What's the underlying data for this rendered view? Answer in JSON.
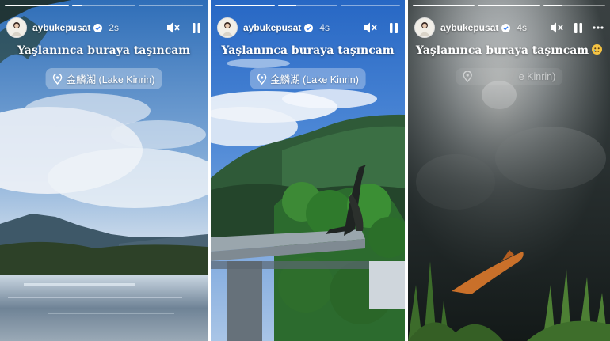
{
  "panels": [
    {
      "username": "aybukepusat",
      "time": "2s",
      "caption": "Yaşlanınca buraya taşıncam",
      "location": "金鱗湖 (Lake Kinrin)",
      "progress": [
        1,
        0.15,
        0
      ]
    },
    {
      "username": "aybukepusat",
      "time": "4s",
      "caption": "Yaşlanınca buraya taşıncam",
      "location": "金鱗湖 (Lake Kinrin)",
      "progress": [
        1,
        0.3,
        0
      ]
    },
    {
      "username": "aybukepusat",
      "time": "4s",
      "caption": "Yaşlanınca buraya taşıncam",
      "location": "e Kinrin)",
      "progress": [
        1,
        1,
        0.3
      ],
      "caption_emoji": "crying-face-emoji"
    }
  ],
  "icons": {
    "verified": "verified-badge-icon",
    "mute": "speaker-muted-icon",
    "pause": "pause-icon",
    "more": "more-options-icon",
    "location": "location-pin-icon"
  },
  "colors": {
    "text": "#ffffff",
    "location_chip": "rgba(255,255,255,0.3)"
  }
}
